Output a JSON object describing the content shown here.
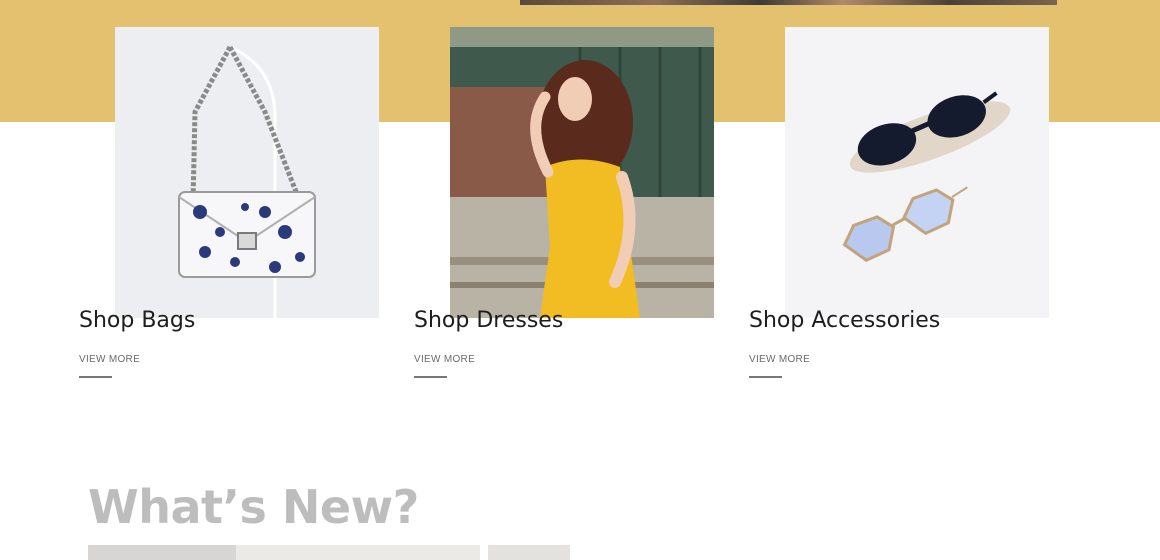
{
  "categories": [
    {
      "title": "Shop Bags",
      "link": "VIEW MORE",
      "image": "handbag-photo"
    },
    {
      "title": "Shop Dresses",
      "link": "VIEW MORE",
      "image": "yellow-dress-model-photo"
    },
    {
      "title": "Shop Accessories",
      "link": "VIEW MORE",
      "image": "sunglasses-photo"
    }
  ],
  "whats_new": {
    "heading": "What’s New?"
  },
  "colors": {
    "accent_band": "#e3c16e",
    "heading_gray": "#bdbdbd"
  }
}
